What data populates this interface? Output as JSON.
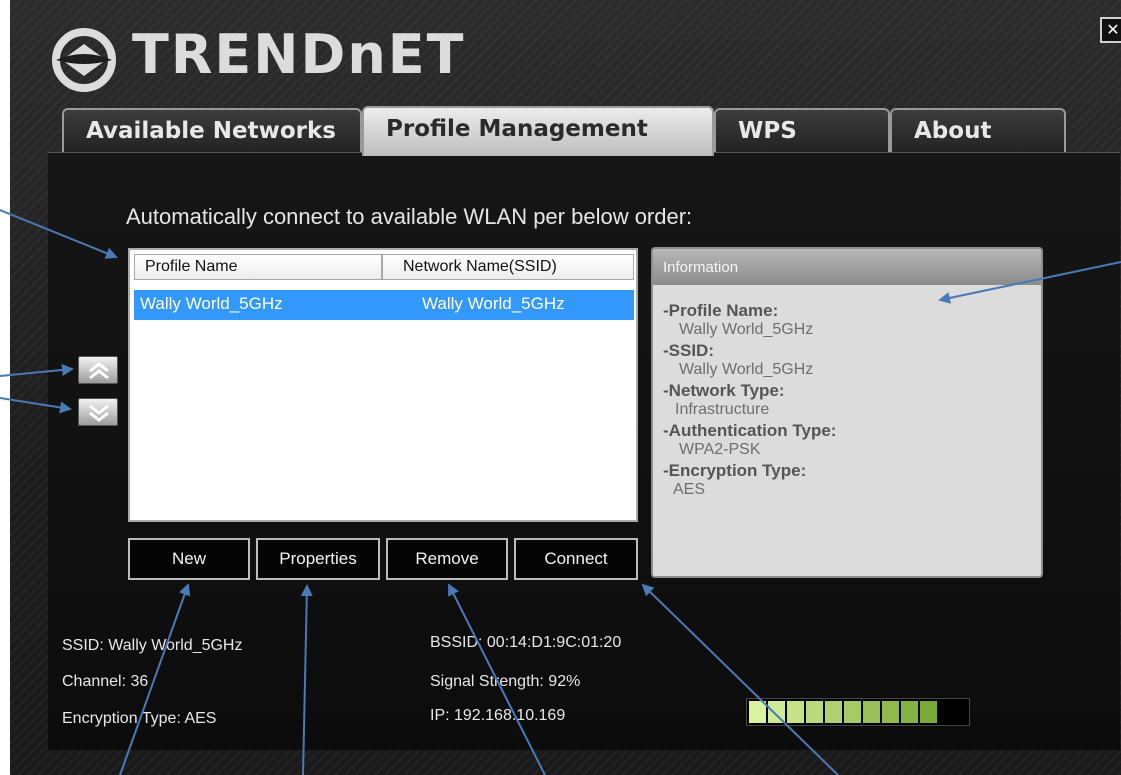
{
  "app": {
    "brand": "TRENDnET",
    "close_glyph": "✕"
  },
  "tabs": [
    {
      "label": "Available Networks",
      "active": false
    },
    {
      "label": "Profile Management",
      "active": true
    },
    {
      "label": "WPS",
      "active": false
    },
    {
      "label": "About",
      "active": false
    }
  ],
  "profile_mgmt": {
    "auto_connect_label": "Automatically connect to available WLAN per below order:",
    "columns": [
      "Profile Name",
      "Network Name(SSID)"
    ],
    "rows": [
      {
        "profile_name": "Wally World_5GHz",
        "ssid": "Wally World_5GHz",
        "selected": true
      }
    ],
    "move_up_icon": "double-chevron-up-icon",
    "move_down_icon": "double-chevron-down-icon",
    "buttons": {
      "new": "New",
      "properties": "Properties",
      "remove": "Remove",
      "connect": "Connect"
    }
  },
  "info": {
    "header": "Information",
    "profile_name_label": "-Profile Name:",
    "profile_name_value": "Wally World_5GHz",
    "ssid_label": "-SSID:",
    "ssid_value": "Wally World_5GHz",
    "network_type_label": "-Network Type:",
    "network_type_value": "Infrastructure",
    "auth_type_label": "-Authentication Type:",
    "auth_type_value": "WPA2-PSK",
    "encryption_type_label": "-Encryption Type:",
    "encryption_type_value": "AES"
  },
  "status": {
    "ssid": "SSID: Wally World_5GHz",
    "channel": "Channel: 36",
    "encryption": "Encryption Type: AES",
    "bssid": "BSSID: 00:14:D1:9C:01:20",
    "signal": "Signal Strength: 92%",
    "ip": "IP: 192.168.10.169",
    "signal_fraction": 0.92
  },
  "colors": {
    "selection": "#3399ff",
    "signal_light": "#d9f2a0",
    "signal_dark": "#6fa32a",
    "annotation_arrow": "#4a7ab5"
  }
}
